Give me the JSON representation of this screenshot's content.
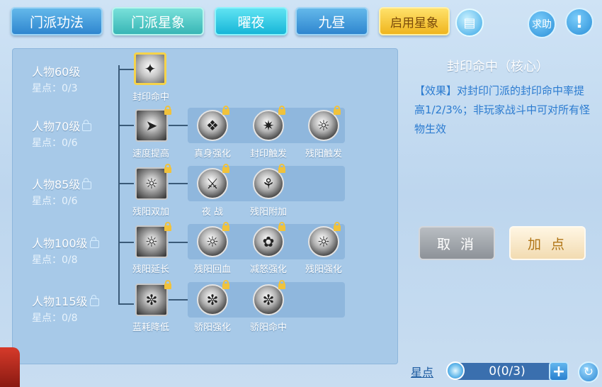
{
  "tabs": [
    "门派功法",
    "门派星象",
    "曜夜",
    "九昼",
    "启用星象"
  ],
  "help_label": "求助",
  "levels": [
    {
      "name": "人物60级",
      "points": "星点：0/3",
      "locked": false
    },
    {
      "name": "人物70级",
      "points": "星点：0/6",
      "locked": true
    },
    {
      "name": "人物85级",
      "points": "星点：0/6",
      "locked": true
    },
    {
      "name": "人物100级",
      "points": "星点：0/8",
      "locked": true
    },
    {
      "name": "人物115级",
      "points": "星点：0/8",
      "locked": true
    }
  ],
  "skills": {
    "r0": [
      "封印命中"
    ],
    "r1": [
      "速度提高",
      "真身强化",
      "封印触发",
      "残阳触发"
    ],
    "r2": [
      "残阳双加",
      "夜 战",
      "残阳附加"
    ],
    "r3": [
      "残阳延长",
      "残阳回血",
      "减怒强化",
      "残阳强化"
    ],
    "r4": [
      "蓝耗降低",
      "骄阳强化",
      "骄阳命中"
    ]
  },
  "detail": {
    "title": "封印命中（核心）",
    "description": "【效果】对封印门派的封印命中率提高1/2/3%；非玩家战斗中可对所有怪物生效"
  },
  "buttons": {
    "cancel": "取 消",
    "add": "加 点"
  },
  "star_points": {
    "label": "星点",
    "value": "0(0/3)"
  },
  "colors": {
    "selected_border": "#f5d34a",
    "description_text": "#2b7bd0",
    "lock": "#f0c23c"
  }
}
